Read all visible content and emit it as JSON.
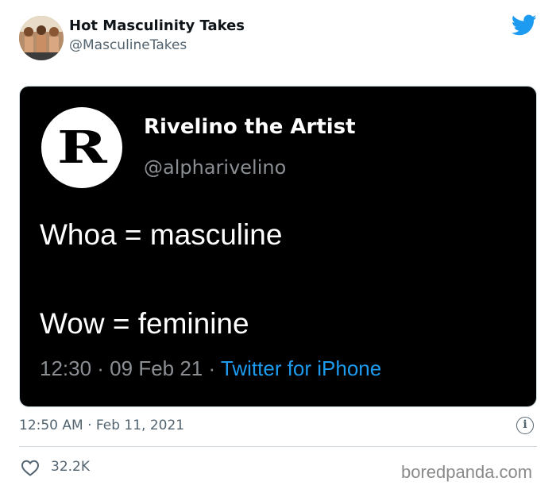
{
  "author": {
    "display_name": "Hot Masculinity Takes",
    "handle": "@MasculineTakes"
  },
  "media": {
    "logo_letter": "R",
    "name": "Rivelino the Artist",
    "handle": "@alpharivelino",
    "line1": "Whoa = masculine",
    "line2": "Wow = feminine",
    "meta_time": "12:30 · 09 Feb 21 · ",
    "meta_source": "Twitter for iPhone"
  },
  "footer": {
    "timestamp": "12:50 AM · Feb 11, 2021",
    "likes": "32.2K",
    "info_glyph": "i"
  },
  "watermark": "boredpanda.com",
  "icons": {
    "brand": "twitter-bird-icon",
    "like": "heart-icon",
    "info": "info-icon"
  },
  "colors": {
    "brand_blue": "#1d9bf0",
    "secondary_text": "#536471"
  }
}
